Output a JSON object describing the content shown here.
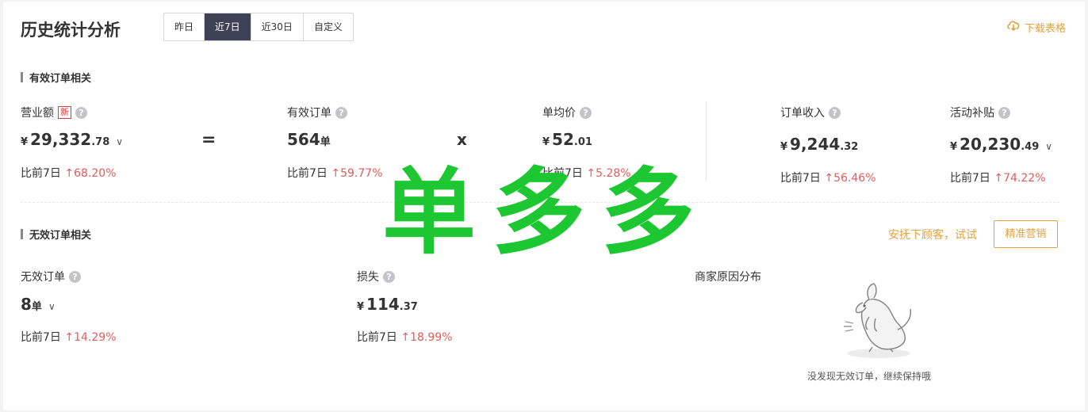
{
  "header": {
    "title": "历史统计分析",
    "tabs": [
      "昨日",
      "近7日",
      "近30日",
      "自定义"
    ],
    "active_tab": "近7日",
    "download": "下载表格"
  },
  "currency": "¥",
  "compare_label": "比前7日",
  "icons": {
    "help": "?",
    "chevron": "∨",
    "up": "↑"
  },
  "valid": {
    "title": "有效订单相关",
    "equals": "=",
    "times": "x",
    "revenue": {
      "label": "营业额",
      "badge": "新",
      "int": "29,332",
      "dec": ".78",
      "change": "68.20%"
    },
    "orders": {
      "label": "有效订单",
      "value": "564",
      "unit": "单",
      "change": "59.77%"
    },
    "avg_price": {
      "label": "单均价",
      "int": "52",
      "dec": ".01",
      "change": "5.28%"
    },
    "income": {
      "label": "订单收入",
      "int": "9,244",
      "dec": ".32",
      "change": "56.46%"
    },
    "subsidy": {
      "label": "活动补贴",
      "int": "20,230",
      "dec": ".49",
      "change": "74.22%"
    }
  },
  "invalid": {
    "title": "无效订单相关",
    "soothe": "安抚下顾客，试试",
    "marketing_btn": "精准营销",
    "orders": {
      "label": "无效订单",
      "value": "8",
      "unit": "单",
      "change": "14.29%"
    },
    "loss": {
      "label": "损失",
      "int": "114",
      "dec": ".37",
      "change": "18.99%"
    },
    "reason_title": "商家原因分布",
    "empty_text": "没发现无效订单，继续保持哦"
  },
  "watermark": "单多多",
  "colors": {
    "accent": "#e1a23c",
    "up": "#e45b5b",
    "active_tab": "#3f4156",
    "watermark": "#1dc731"
  }
}
